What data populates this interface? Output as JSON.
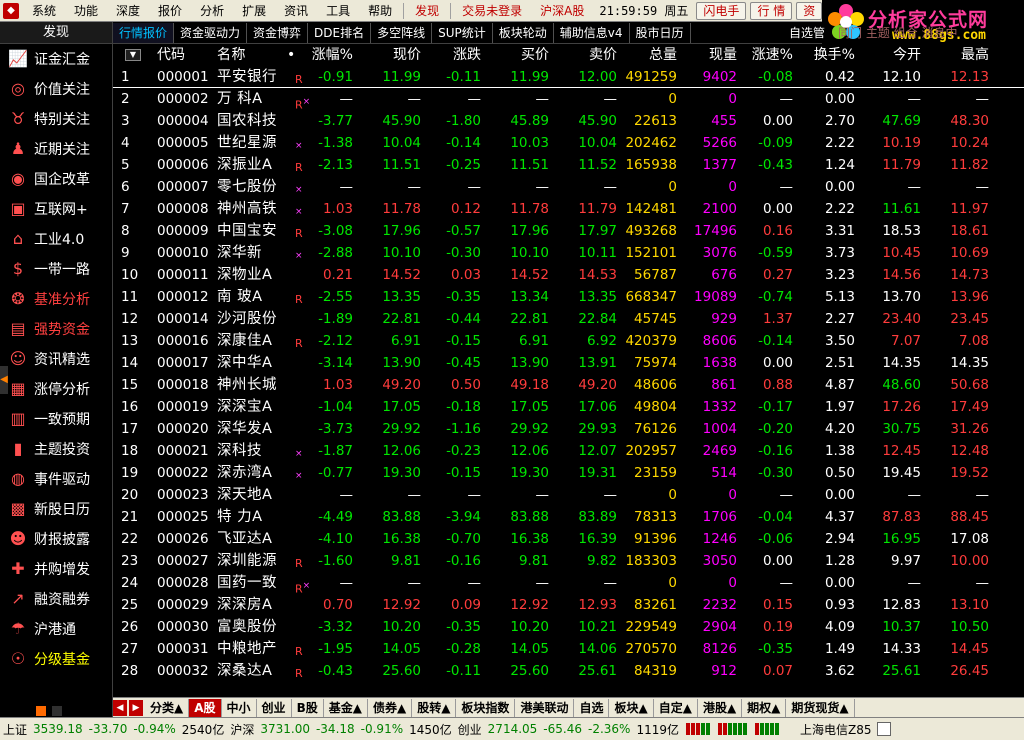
{
  "menubar": {
    "items": [
      "系统",
      "功能",
      "深度",
      "报价",
      "分析",
      "扩展",
      "资讯",
      "工具",
      "帮助"
    ],
    "red_items": [
      "发现",
      "交易未登录",
      "沪深A股"
    ],
    "clock": "21:59:59 周五",
    "buttons": [
      "闪电手",
      "行 情",
      "资"
    ]
  },
  "logo": {
    "title": "分析家公式网",
    "url": "www.88gs.com"
  },
  "sidebar": {
    "head": "发现",
    "items": [
      {
        "label": "证金汇金",
        "icon": "chart-line-icon"
      },
      {
        "label": "价值关注",
        "icon": "target-icon"
      },
      {
        "label": "特别关注",
        "icon": "bull-icon"
      },
      {
        "label": "近期关注",
        "icon": "person-icon"
      },
      {
        "label": "国企改革",
        "icon": "coins-icon"
      },
      {
        "label": "互联网+",
        "icon": "computer-icon"
      },
      {
        "label": "工业4.0",
        "icon": "factory-icon"
      },
      {
        "label": "一带一路",
        "icon": "money-bag-icon"
      },
      {
        "label": "基准分析",
        "icon": "pig-icon"
      },
      {
        "label": "强势资金",
        "icon": "wallet-icon"
      },
      {
        "label": "资讯精选",
        "icon": "person-reading-icon"
      },
      {
        "label": "涨停分析",
        "icon": "briefcase-icon"
      },
      {
        "label": "一致预期",
        "icon": "calendar-icon"
      },
      {
        "label": "主题投资",
        "icon": "bar-chart-icon"
      },
      {
        "label": "事件驱动",
        "icon": "globe-icon"
      },
      {
        "label": "新股日历",
        "icon": "calendar-grid-icon"
      },
      {
        "label": "财报披露",
        "icon": "person-desk-icon"
      },
      {
        "label": "并购增发",
        "icon": "plus-bars-icon"
      },
      {
        "label": "融资融券",
        "icon": "trend-icon"
      },
      {
        "label": "沪港通",
        "icon": "umbrella-icon"
      },
      {
        "label": "分级基金",
        "icon": "user-icon"
      }
    ]
  },
  "tabs": [
    "行情报价",
    "资金驱动力",
    "资金博弈",
    "DDE排名",
    "多空阵线",
    "SUP统计",
    "板块轮动",
    "辅助信息v4",
    "股市日历"
  ],
  "watchlist": {
    "label": "自选管",
    "extra": "同门 主题 组合 消息中"
  },
  "columns": [
    "代码",
    "名称",
    "•",
    "涨幅%",
    "现价",
    "涨跌",
    "买价",
    "卖价",
    "总量",
    "现量",
    "涨速%",
    "换手%",
    "今开",
    "最高"
  ],
  "colors": {
    "up": "#ff3c3c",
    "down": "#00e600",
    "volume": "#ffd800",
    "current": "#ff00ff",
    "white": "#ffffff"
  },
  "rows": [
    {
      "i": "1",
      "code": "000001",
      "name": "平安银行",
      "flag": "R",
      "chg": "-0.91",
      "price": "11.99",
      "diff": "-0.11",
      "bid": "11.99",
      "ask": "12.00",
      "vol": "491259",
      "cur": "9402",
      "spd": "-0.08",
      "turn": "0.42",
      "open": "12.10",
      "high": "12.13"
    },
    {
      "i": "2",
      "code": "000002",
      "name": "万 科A",
      "flag": "R",
      "sup": "×",
      "chg": "—",
      "price": "—",
      "diff": "—",
      "bid": "—",
      "ask": "—",
      "vol": "0",
      "cur": "0",
      "spd": "—",
      "turn": "0.00",
      "open": "—",
      "high": "—"
    },
    {
      "i": "3",
      "code": "000004",
      "name": "国农科技",
      "flag": "",
      "chg": "-3.77",
      "price": "45.90",
      "diff": "-1.80",
      "bid": "45.89",
      "ask": "45.90",
      "vol": "22613",
      "cur": "455",
      "spd": "0.00",
      "turn": "2.70",
      "open": "47.69",
      "high": "48.30"
    },
    {
      "i": "4",
      "code": "000005",
      "name": "世纪星源",
      "flag": "",
      "sup": "×",
      "chg": "-1.38",
      "price": "10.04",
      "diff": "-0.14",
      "bid": "10.03",
      "ask": "10.04",
      "vol": "202462",
      "cur": "5266",
      "spd": "-0.09",
      "turn": "2.22",
      "open": "10.19",
      "high": "10.24"
    },
    {
      "i": "5",
      "code": "000006",
      "name": "深振业A",
      "flag": "R",
      "chg": "-2.13",
      "price": "11.51",
      "diff": "-0.25",
      "bid": "11.51",
      "ask": "11.52",
      "vol": "165938",
      "cur": "1377",
      "spd": "-0.43",
      "turn": "1.24",
      "open": "11.79",
      "high": "11.82"
    },
    {
      "i": "6",
      "code": "000007",
      "name": "零七股份",
      "flag": "",
      "sup": "×",
      "chg": "—",
      "price": "—",
      "diff": "—",
      "bid": "—",
      "ask": "—",
      "vol": "0",
      "cur": "0",
      "spd": "—",
      "turn": "0.00",
      "open": "—",
      "high": "—"
    },
    {
      "i": "7",
      "code": "000008",
      "name": "神州高铁",
      "flag": "",
      "sup": "×",
      "chg": "1.03",
      "price": "11.78",
      "diff": "0.12",
      "bid": "11.78",
      "ask": "11.79",
      "vol": "142481",
      "cur": "2100",
      "spd": "0.00",
      "turn": "2.22",
      "open": "11.61",
      "high": "11.97"
    },
    {
      "i": "8",
      "code": "000009",
      "name": "中国宝安",
      "flag": "R",
      "chg": "-3.08",
      "price": "17.96",
      "diff": "-0.57",
      "bid": "17.96",
      "ask": "17.97",
      "vol": "493268",
      "cur": "17496",
      "spd": "0.16",
      "turn": "3.31",
      "open": "18.53",
      "high": "18.61"
    },
    {
      "i": "9",
      "code": "000010",
      "name": "深华新",
      "flag": "",
      "sup": "×",
      "chg": "-2.88",
      "price": "10.10",
      "diff": "-0.30",
      "bid": "10.10",
      "ask": "10.11",
      "vol": "152101",
      "cur": "3076",
      "spd": "-0.59",
      "turn": "3.73",
      "open": "10.45",
      "high": "10.69"
    },
    {
      "i": "10",
      "code": "000011",
      "name": "深物业A",
      "flag": "",
      "chg": "0.21",
      "price": "14.52",
      "diff": "0.03",
      "bid": "14.52",
      "ask": "14.53",
      "vol": "56787",
      "cur": "676",
      "spd": "0.27",
      "turn": "3.23",
      "open": "14.56",
      "high": "14.73"
    },
    {
      "i": "11",
      "code": "000012",
      "name": "南 玻A",
      "flag": "R",
      "chg": "-2.55",
      "price": "13.35",
      "diff": "-0.35",
      "bid": "13.34",
      "ask": "13.35",
      "vol": "668347",
      "cur": "19089",
      "spd": "-0.74",
      "turn": "5.13",
      "open": "13.70",
      "high": "13.96"
    },
    {
      "i": "12",
      "code": "000014",
      "name": "沙河股份",
      "flag": "",
      "chg": "-1.89",
      "price": "22.81",
      "diff": "-0.44",
      "bid": "22.81",
      "ask": "22.84",
      "vol": "45745",
      "cur": "929",
      "spd": "1.37",
      "turn": "2.27",
      "open": "23.40",
      "high": "23.45"
    },
    {
      "i": "13",
      "code": "000016",
      "name": "深康佳A",
      "flag": "R",
      "chg": "-2.12",
      "price": "6.91",
      "diff": "-0.15",
      "bid": "6.91",
      "ask": "6.92",
      "vol": "420379",
      "cur": "8606",
      "spd": "-0.14",
      "turn": "3.50",
      "open": "7.07",
      "high": "7.08"
    },
    {
      "i": "14",
      "code": "000017",
      "name": "深中华A",
      "flag": "",
      "chg": "-3.14",
      "price": "13.90",
      "diff": "-0.45",
      "bid": "13.90",
      "ask": "13.91",
      "vol": "75974",
      "cur": "1638",
      "spd": "0.00",
      "turn": "2.51",
      "open": "14.35",
      "high": "14.35"
    },
    {
      "i": "15",
      "code": "000018",
      "name": "神州长城",
      "flag": "",
      "chg": "1.03",
      "price": "49.20",
      "diff": "0.50",
      "bid": "49.18",
      "ask": "49.20",
      "vol": "48606",
      "cur": "861",
      "spd": "0.88",
      "turn": "4.87",
      "open": "48.60",
      "high": "50.68"
    },
    {
      "i": "16",
      "code": "000019",
      "name": "深深宝A",
      "flag": "",
      "chg": "-1.04",
      "price": "17.05",
      "diff": "-0.18",
      "bid": "17.05",
      "ask": "17.06",
      "vol": "49804",
      "cur": "1332",
      "spd": "-0.17",
      "turn": "1.97",
      "open": "17.26",
      "high": "17.49"
    },
    {
      "i": "17",
      "code": "000020",
      "name": "深华发A",
      "flag": "",
      "chg": "-3.73",
      "price": "29.92",
      "diff": "-1.16",
      "bid": "29.92",
      "ask": "29.93",
      "vol": "76126",
      "cur": "1004",
      "spd": "-0.20",
      "turn": "4.20",
      "open": "30.75",
      "high": "31.26"
    },
    {
      "i": "18",
      "code": "000021",
      "name": "深科技",
      "flag": "",
      "sup": "×",
      "chg": "-1.87",
      "price": "12.06",
      "diff": "-0.23",
      "bid": "12.06",
      "ask": "12.07",
      "vol": "202957",
      "cur": "2469",
      "spd": "-0.16",
      "turn": "1.38",
      "open": "12.45",
      "high": "12.48"
    },
    {
      "i": "19",
      "code": "000022",
      "name": "深赤湾A",
      "flag": "",
      "sup": "×",
      "chg": "-0.77",
      "price": "19.30",
      "diff": "-0.15",
      "bid": "19.30",
      "ask": "19.31",
      "vol": "23159",
      "cur": "514",
      "spd": "-0.30",
      "turn": "0.50",
      "open": "19.45",
      "high": "19.52"
    },
    {
      "i": "20",
      "code": "000023",
      "name": "深天地A",
      "flag": "",
      "chg": "—",
      "price": "—",
      "diff": "—",
      "bid": "—",
      "ask": "—",
      "vol": "0",
      "cur": "0",
      "spd": "—",
      "turn": "0.00",
      "open": "—",
      "high": "—"
    },
    {
      "i": "21",
      "code": "000025",
      "name": "特 力A",
      "flag": "",
      "chg": "-4.49",
      "price": "83.88",
      "diff": "-3.94",
      "bid": "83.88",
      "ask": "83.89",
      "vol": "78313",
      "cur": "1706",
      "spd": "-0.04",
      "turn": "4.37",
      "open": "87.83",
      "high": "88.45"
    },
    {
      "i": "22",
      "code": "000026",
      "name": "飞亚达A",
      "flag": "",
      "chg": "-4.10",
      "price": "16.38",
      "diff": "-0.70",
      "bid": "16.38",
      "ask": "16.39",
      "vol": "91396",
      "cur": "1246",
      "spd": "-0.06",
      "turn": "2.94",
      "open": "16.95",
      "high": "17.08"
    },
    {
      "i": "23",
      "code": "000027",
      "name": "深圳能源",
      "flag": "R",
      "chg": "-1.60",
      "price": "9.81",
      "diff": "-0.16",
      "bid": "9.81",
      "ask": "9.82",
      "vol": "183303",
      "cur": "3050",
      "spd": "0.00",
      "turn": "1.28",
      "open": "9.97",
      "high": "10.00"
    },
    {
      "i": "24",
      "code": "000028",
      "name": "国药一致",
      "flag": "R",
      "sup": "×",
      "chg": "—",
      "price": "—",
      "diff": "—",
      "bid": "—",
      "ask": "—",
      "vol": "0",
      "cur": "0",
      "spd": "—",
      "turn": "0.00",
      "open": "—",
      "high": "—"
    },
    {
      "i": "25",
      "code": "000029",
      "name": "深深房A",
      "flag": "",
      "chg": "0.70",
      "price": "12.92",
      "diff": "0.09",
      "bid": "12.92",
      "ask": "12.93",
      "vol": "83261",
      "cur": "2232",
      "spd": "0.15",
      "turn": "0.93",
      "open": "12.83",
      "high": "13.10"
    },
    {
      "i": "26",
      "code": "000030",
      "name": "富奥股份",
      "flag": "",
      "chg": "-3.32",
      "price": "10.20",
      "diff": "-0.35",
      "bid": "10.20",
      "ask": "10.21",
      "vol": "229549",
      "cur": "2904",
      "spd": "0.19",
      "turn": "4.09",
      "open": "10.37",
      "high": "10.50"
    },
    {
      "i": "27",
      "code": "000031",
      "name": "中粮地产",
      "flag": "R",
      "chg": "-1.95",
      "price": "14.05",
      "diff": "-0.28",
      "bid": "14.05",
      "ask": "14.06",
      "vol": "270570",
      "cur": "8126",
      "spd": "-0.35",
      "turn": "1.49",
      "open": "14.33",
      "high": "14.45"
    },
    {
      "i": "28",
      "code": "000032",
      "name": "深桑达A",
      "flag": "R",
      "chg": "-0.43",
      "price": "25.60",
      "diff": "-0.11",
      "bid": "25.60",
      "ask": "25.61",
      "vol": "84319",
      "cur": "912",
      "spd": "0.07",
      "turn": "3.62",
      "open": "25.61",
      "high": "26.45"
    }
  ],
  "bottom_tabs": [
    "分类▲",
    "A股",
    "中小",
    "创业",
    "B股",
    "基金▲",
    "债券▲",
    "股转▲",
    "板块指数",
    "港美联动",
    "自选",
    "板块▲",
    "自定▲",
    "港股▲",
    "期权▲",
    "期货现货▲"
  ],
  "status": {
    "sh_label": "上证",
    "sh_index": "3539.18",
    "sh_diff": "-33.70",
    "sh_pct": "-0.94%",
    "sh_amount": "2540亿",
    "sz_label": "沪深",
    "sz_index": "3731.00",
    "sz_diff": "-34.18",
    "sz_pct": "-0.91%",
    "sz_amount": "1450亿",
    "cy_label": "创业",
    "cy_index": "2714.05",
    "cy_diff": "-65.46",
    "cy_pct": "-2.36%",
    "cy_amount": "1119亿",
    "server": "上海电信Z85"
  }
}
